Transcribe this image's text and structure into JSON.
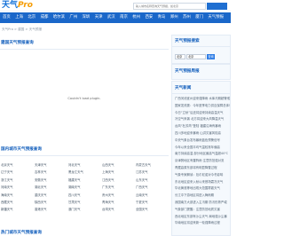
{
  "header": {
    "logo_cn": "天气",
    "logo_en": "Pro",
    "search_placeholder": "输入城市名称查询天气预报，如北京"
  },
  "nav": [
    "首页",
    "上海",
    "北京",
    "成都",
    "哈尔滨",
    "广州",
    "深圳",
    "天津",
    "武汉",
    "南京",
    "杭州",
    "西安",
    "青岛",
    "郑州",
    "苏州",
    "厦门",
    "天气预报"
  ],
  "main": {
    "breadcrumb": "天气Pro > 建国 > 天气预报",
    "section1_title": "建国天气预报查询",
    "map_message": "Couldn't load plugin.",
    "section2_title": "国内城市天气预报查询",
    "section3_title": "热门城市天气预报查询",
    "cities": [
      "北京天气",
      "天津天气",
      "河北天气",
      "山西天气",
      "内蒙古天气",
      "辽宁天气",
      "吉林天气",
      "黑龙江天气",
      "上海天气",
      "江苏天气",
      "浙江天气",
      "安徽天气",
      "福建天气",
      "江西天气",
      "山东天气",
      "河南天气",
      "湖北天气",
      "湖南天气",
      "广东天气",
      "广西天气",
      "海南天气",
      "重庆天气",
      "四川天气",
      "贵州天气",
      "云南天气",
      "西藏天气",
      "陕西天气",
      "甘肃天气",
      "青海天气",
      "宁夏天气",
      "新疆天气",
      "香港天气",
      "澳门天气",
      "台湾天气",
      "全国天气"
    ]
  },
  "sidebar": {
    "search_title": "天气预报搜索",
    "province": "北京",
    "city": "北京",
    "query_button": "查询",
    "weekly_title": "天气预报周报",
    "news_title": "天气新闻",
    "news": [
      "广西河池宜州迎来强降雨 水库汛期超警戒",
      "国家发改委：今年夏季电力供应保障总体有保障",
      "今日“立秋”后还将迎来持续高温天气",
      "冷空气来袭 北方将迎来大风降温天气",
      "台风“杜苏芮”登陆 福建沿海有暴雨",
      "四川多地迎来暴雨 山洪灾害风险高",
      "中央气象台发布暴雨蓝色预警信号",
      "今年以来全国平均气温较常年偏高",
      "南方持续高温 部分地区最高气温超40℃",
      "京津冀地区有雷阵雨 注意防范强对流",
      "青藏高原东部将有明显降雪过程",
      "气象专家解读：厄尔尼诺对今冬影响",
      "东北地区迎来入秋以来首场霜冻天气",
      "华北黄淮等地出现大范围雾霾天气",
      "长江中下游地区将进入梅雨期",
      "我国南方大部进入主汛期 防汛形势严峻",
      "气象部门提醒：注意防范地质灾害",
      "西北地区东部有沙尘天气 局地强沙尘暴",
      "华南地区将迎来新一轮强降雨过程"
    ]
  },
  "colors": {
    "brand_blue": "#1a67c9",
    "title_blue": "#1560bd",
    "logo_orange": "#f59b00"
  }
}
